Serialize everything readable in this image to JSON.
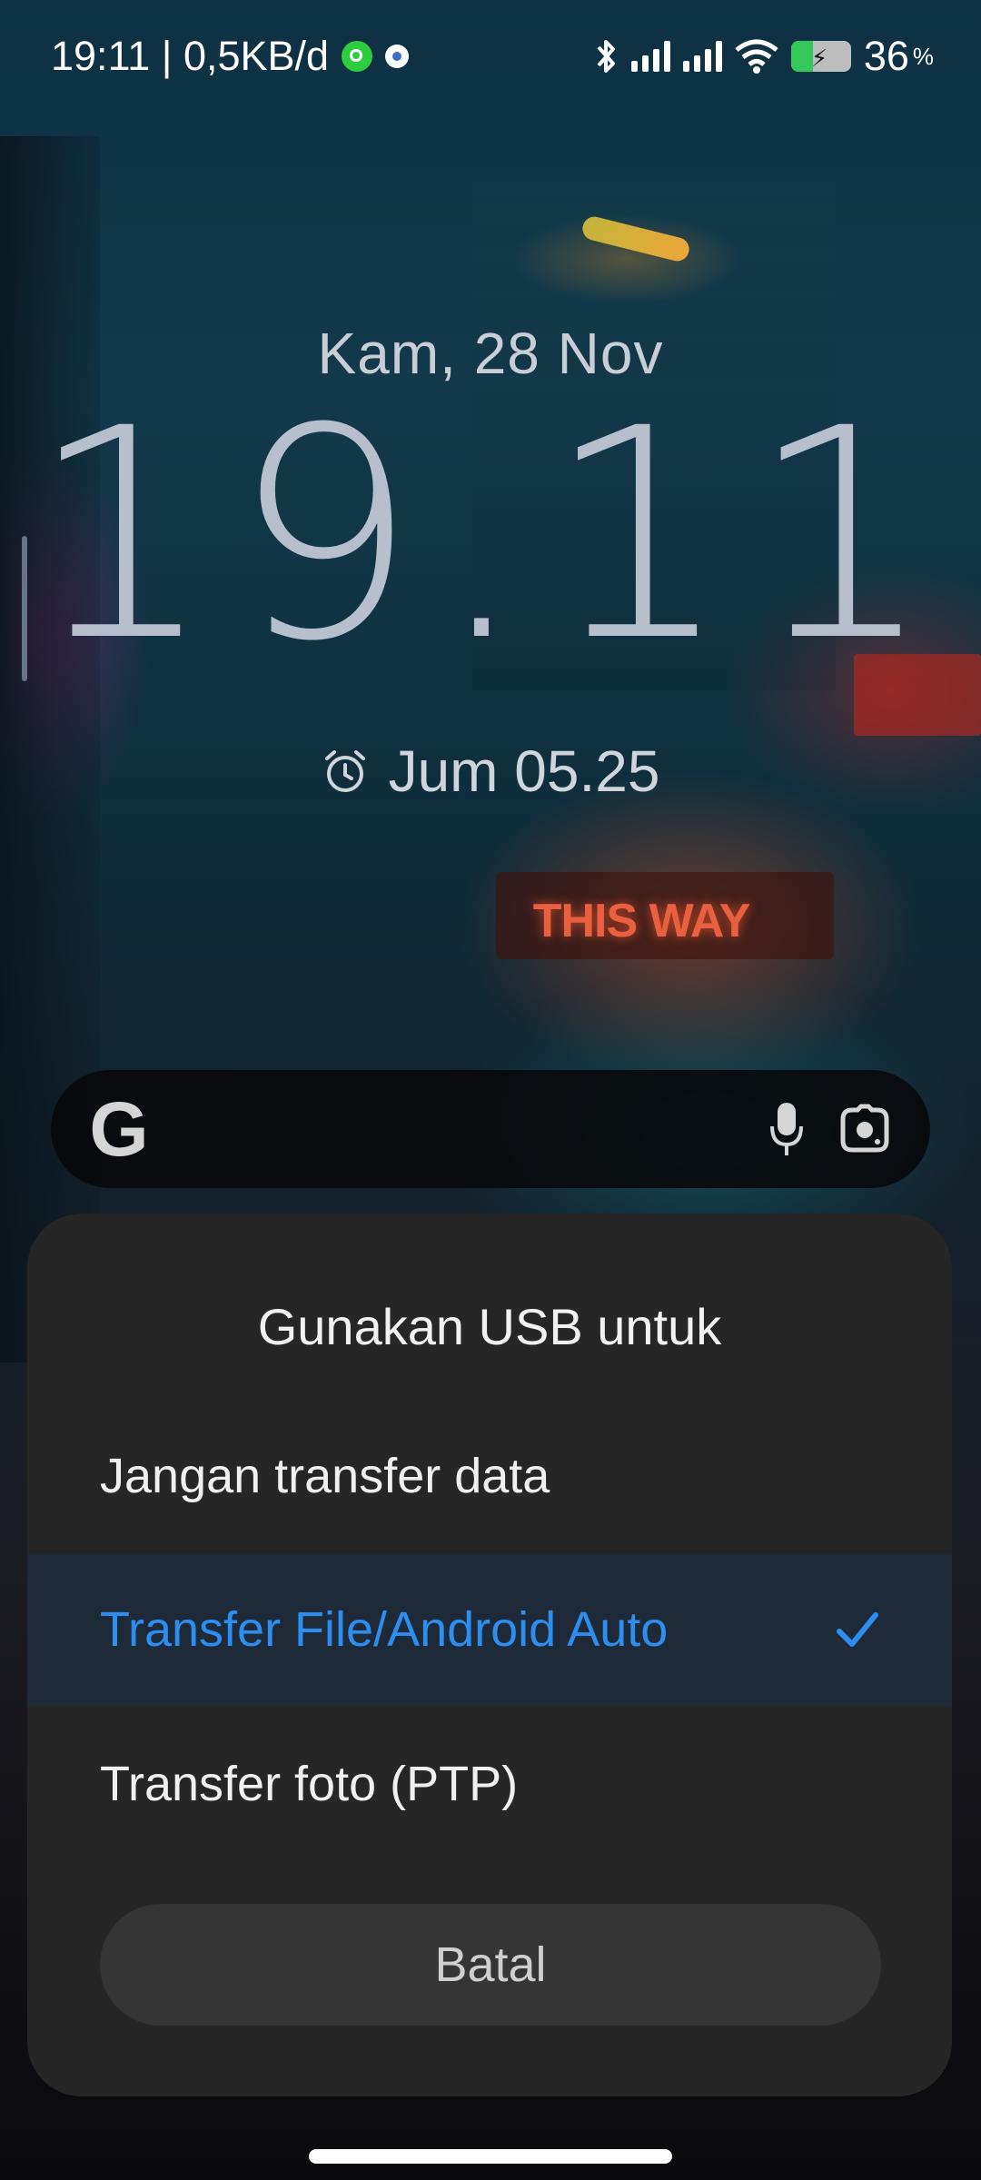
{
  "status_bar": {
    "time_speed": "19:11 | 0,5KB/d",
    "battery_percent": "36",
    "battery_level": 0.36,
    "pct_sign": "%",
    "icons": [
      "whatsapp-icon",
      "settings-notification-icon",
      "bluetooth-icon",
      "signal-icon",
      "signal-icon",
      "wifi-icon",
      "battery-charging-icon"
    ]
  },
  "lockscreen": {
    "date": "Kam, 28 Nov",
    "time": "19.11",
    "alarm": "Jum 05.25",
    "wallpaper_sign": "THIS WAY"
  },
  "search_bar": {
    "logo": "G",
    "icons": [
      "google-logo",
      "mic-icon",
      "google-lens-icon"
    ]
  },
  "usb_dialog": {
    "title": "Gunakan USB untuk",
    "options": [
      {
        "label": "Jangan transfer data",
        "selected": false
      },
      {
        "label": "Transfer File/Android Auto",
        "selected": true
      },
      {
        "label": "Transfer foto (PTP)",
        "selected": false
      }
    ],
    "cancel_label": "Batal",
    "accent_color": "#2b8ef0"
  }
}
